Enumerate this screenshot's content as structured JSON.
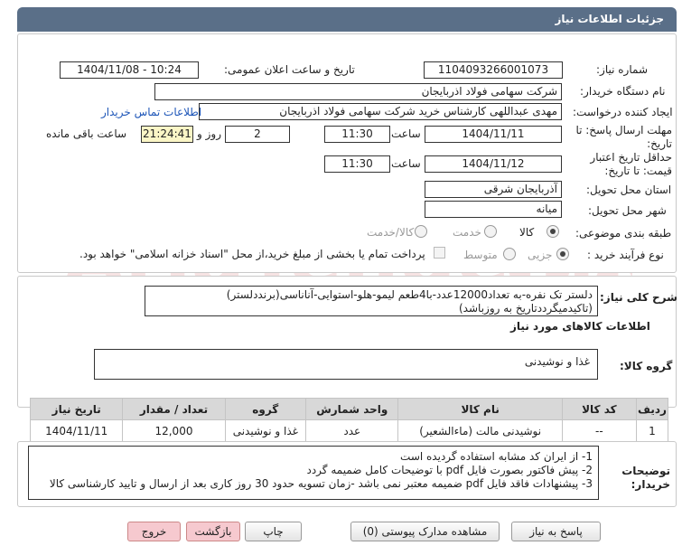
{
  "header": {
    "title": "جزئیات اطلاعات نیاز"
  },
  "fields": {
    "need_number_label": "شماره نیاز:",
    "need_number": "1104093266001073",
    "announce_label": "تاریخ و ساعت اعلان عمومی:",
    "announce_value": "1404/11/08 - 10:24",
    "buyer_label": "نام دستگاه خریدار:",
    "buyer_value": "شرکت سهامی فولاد اذربایجان",
    "creator_label": "ایجاد کننده درخواست:",
    "creator_value": "مهدی عبداللهی کارشناس خرید شرکت سهامی فولاد اذربایجان",
    "contact_link": "اطلاعات تماس خریدار",
    "deadline_label": "مهلت ارسال پاسخ: تا تاریخ:",
    "deadline_date": "1404/11/11",
    "time_label": "ساعت",
    "deadline_time": "11:30",
    "days_value": "2",
    "days_label": "روز و",
    "remaining_time": "21:24:41",
    "remaining_label": "ساعت باقی مانده",
    "validity_label": "حداقل تاریخ اعتبار قیمت: تا تاریخ:",
    "validity_date": "1404/11/12",
    "validity_time": "11:30",
    "province_label": "استان محل تحویل:",
    "province_value": "آذربایجان شرقی",
    "city_label": "شهر محل تحویل:",
    "city_value": "میانه",
    "category_label": "طبقه بندی موضوعی:",
    "category_options": [
      "کالا",
      "خدمت",
      "کالا/خدمت"
    ],
    "process_label": "نوع فرآیند خرید :",
    "process_options": [
      "جزیی",
      "متوسط"
    ],
    "payment_note": "پرداخت تمام یا بخشی از مبلغ خرید،از محل \"اسناد خزانه اسلامی\" خواهد بود."
  },
  "summary": {
    "label": "شرح کلی نیاز:",
    "text_line1": "دلستر تک نفره-به تعداد12000عدد-با4طعم لیمو-هلو-استوایی-آناناسی(برنددلستر)",
    "text_line2": "(تاکیدمیگرددتاریخ به روزباشد)"
  },
  "goods": {
    "section_title": "اطلاعات کالاهای مورد نیاز",
    "group_label": "گروه کالا:",
    "group_value": "غذا و نوشیدنی",
    "columns": [
      "ردیف",
      "کد کالا",
      "نام کالا",
      "واحد شمارش",
      "گروه",
      "تعداد / مقدار",
      "تاریخ نیاز"
    ],
    "rows": [
      [
        "1",
        "--",
        "نوشیدنی مالت (ماءالشعیر)",
        "عدد",
        "غذا و نوشیدنی",
        "12,000",
        "1404/11/11"
      ]
    ]
  },
  "notes": {
    "label": "توضیحات خریدار:",
    "lines": [
      "1- از ایران کد مشابه استفاده گردیده است",
      "2- پیش فاکتور بصورت فایل pdf با توضیحات کامل ضمیمه گردد",
      "3- پیشنهادات فاقد فایل pdf  ضمیمه معتبر نمی باشد -زمان تسویه حدود 30  روز کاری بعد از ارسال و تایید کارشناسی کالا"
    ]
  },
  "buttons": {
    "reply": "پاسخ به نیاز",
    "docs": "مشاهده مدارک پیوستی (0)",
    "print": "چاپ",
    "back": "بازگشت",
    "exit": "خروج"
  },
  "colors": {
    "header_bg": "#5a6f88",
    "yellow": "#fbf6c6",
    "link": "#1e56b8",
    "pink": "#f6c9cf"
  },
  "watermark": "AriaTender.net"
}
